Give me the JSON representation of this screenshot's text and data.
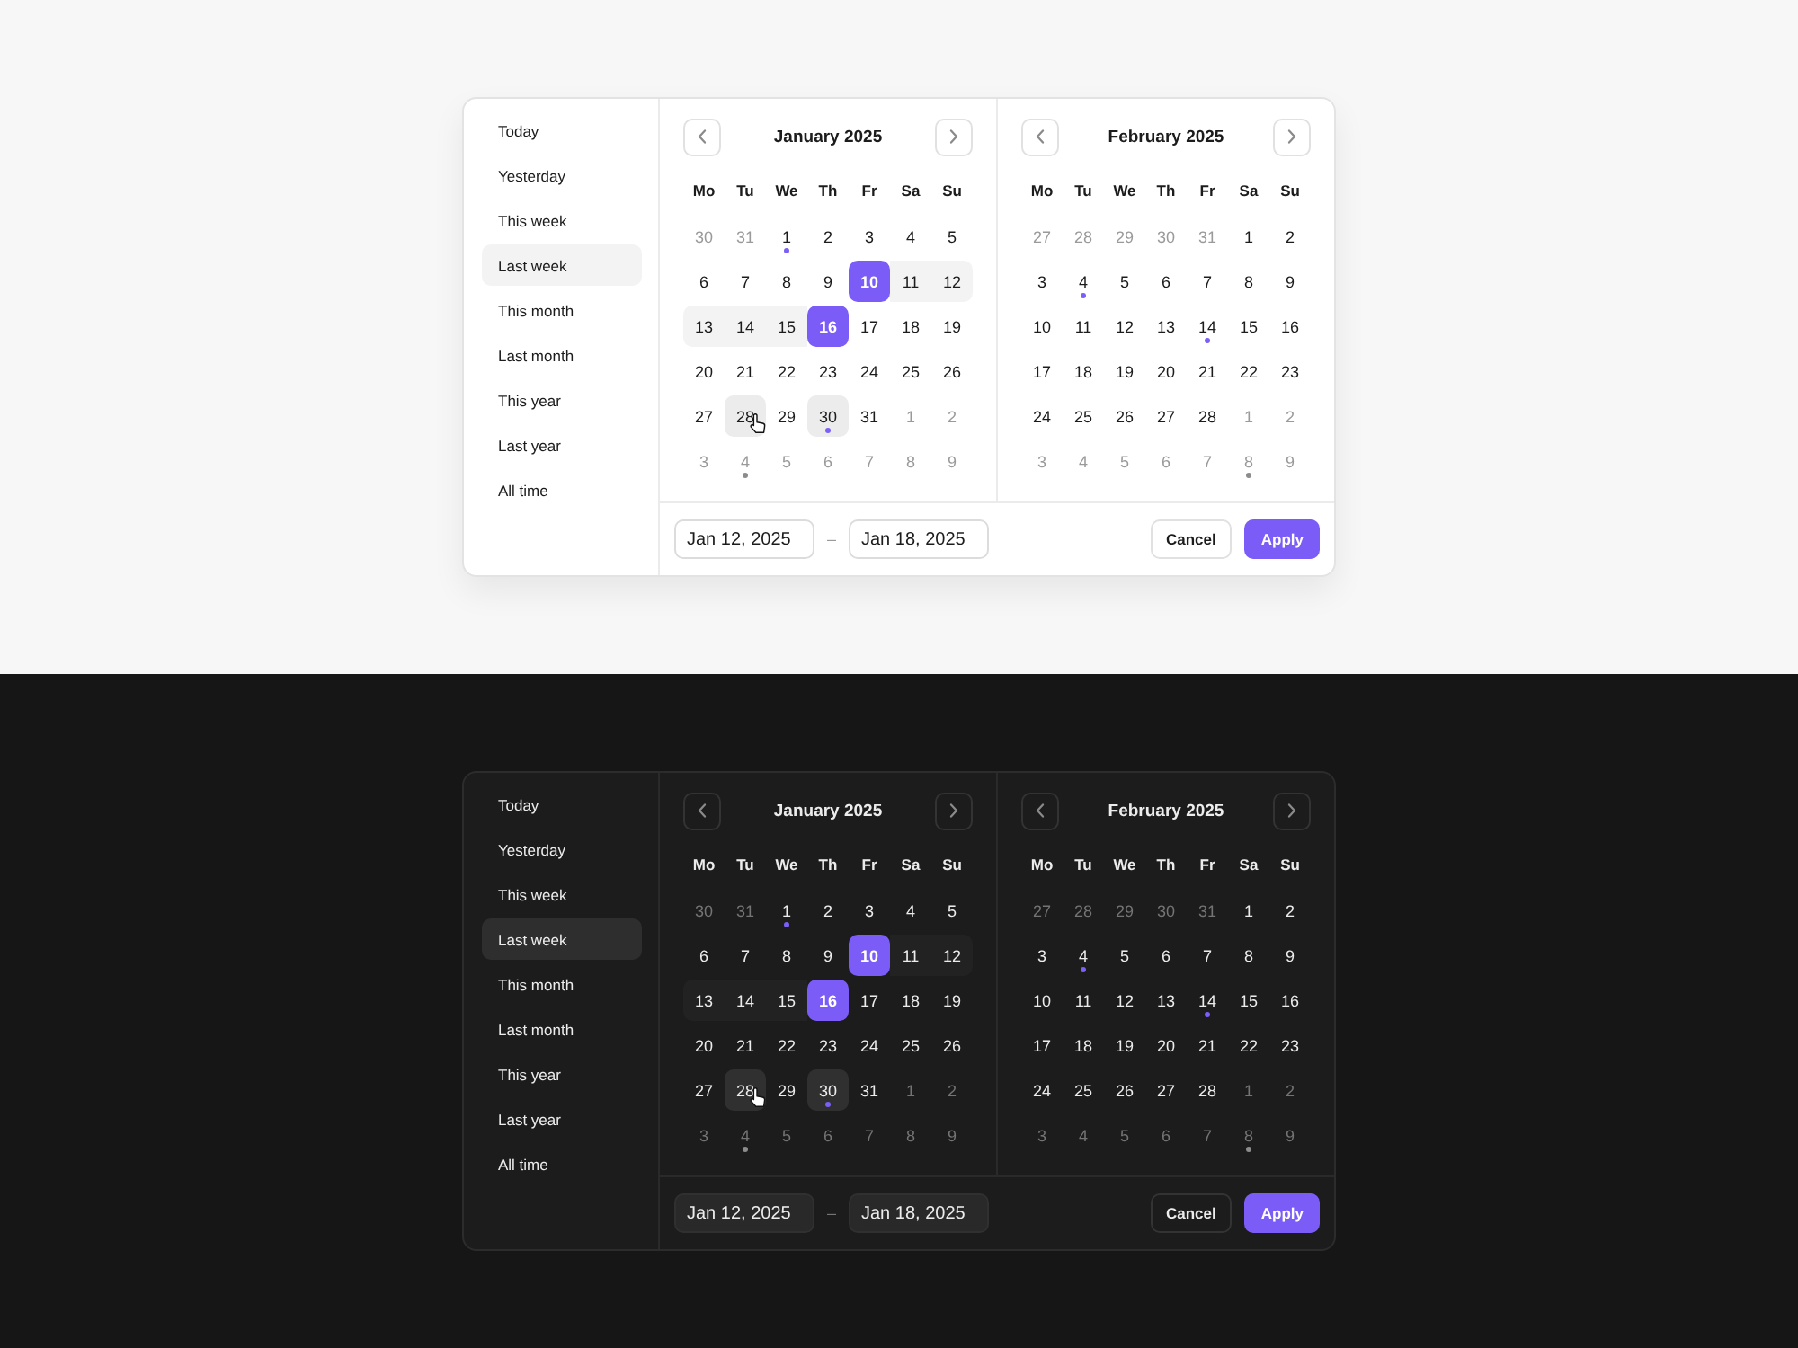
{
  "panels": [
    {
      "kind": "light",
      "presets": [
        {
          "label": "Today",
          "selected": false
        },
        {
          "label": "Yesterday",
          "selected": false
        },
        {
          "label": "This week",
          "selected": false
        },
        {
          "label": "Last week",
          "selected": true
        },
        {
          "label": "This month",
          "selected": false
        },
        {
          "label": "Last month",
          "selected": false
        },
        {
          "label": "This year",
          "selected": false
        },
        {
          "label": "Last year",
          "selected": false
        },
        {
          "label": "All time",
          "selected": false
        }
      ],
      "months": [
        {
          "title": "January 2025",
          "weekdays": [
            "Mo",
            "Tu",
            "We",
            "Th",
            "Fr",
            "Sa",
            "Su"
          ],
          "days": [
            {
              "label": "30",
              "kind": "outside",
              "selected": false
            },
            {
              "label": "31",
              "kind": "outside",
              "selected": false
            },
            {
              "label": "1",
              "kind": "plain",
              "selected": false,
              "color": "#7b5ff6"
            },
            {
              "label": "2",
              "kind": "plain",
              "selected": false
            },
            {
              "label": "3",
              "kind": "plain",
              "selected": false
            },
            {
              "label": "4",
              "kind": "plain",
              "selected": false
            },
            {
              "label": "5",
              "kind": "plain",
              "selected": false
            },
            {
              "label": "6",
              "kind": "plain",
              "selected": false
            },
            {
              "label": "7",
              "kind": "plain",
              "selected": false
            },
            {
              "label": "8",
              "kind": "plain",
              "selected": false
            },
            {
              "label": "9",
              "kind": "plain",
              "selected": false
            },
            {
              "label": "10",
              "kind": "plain",
              "selected": true
            },
            {
              "label": "11",
              "kind": "range",
              "selected": false
            },
            {
              "label": "12",
              "kind": "range",
              "selected": false
            },
            {
              "label": "13",
              "kind": "range",
              "selected": false
            },
            {
              "label": "14",
              "kind": "range",
              "selected": false
            },
            {
              "label": "15",
              "kind": "range",
              "selected": false
            },
            {
              "label": "16",
              "kind": "plain",
              "selected": true
            },
            {
              "label": "17",
              "kind": "plain",
              "selected": false
            },
            {
              "label": "18",
              "kind": "plain",
              "selected": false
            },
            {
              "label": "19",
              "kind": "plain",
              "selected": false
            },
            {
              "label": "20",
              "kind": "plain",
              "selected": false
            },
            {
              "label": "21",
              "kind": "plain",
              "selected": false
            },
            {
              "label": "22",
              "kind": "plain",
              "selected": false
            },
            {
              "label": "23",
              "kind": "plain",
              "selected": false
            },
            {
              "label": "24",
              "kind": "plain",
              "selected": false
            },
            {
              "label": "25",
              "kind": "plain",
              "selected": false
            },
            {
              "label": "26",
              "kind": "plain",
              "selected": false
            },
            {
              "label": "27",
              "kind": "plain",
              "selected": false
            },
            {
              "label": "28",
              "kind": "hover",
              "selected": false
            },
            {
              "label": "29",
              "kind": "plain",
              "selected": false
            },
            {
              "label": "30",
              "kind": "today",
              "selected": false,
              "color": "#7b5ff6"
            },
            {
              "label": "31",
              "kind": "plain",
              "selected": false
            },
            {
              "label": "1",
              "kind": "outside",
              "selected": false
            },
            {
              "label": "2",
              "kind": "outside",
              "selected": false
            },
            {
              "label": "3",
              "kind": "outside",
              "selected": false
            },
            {
              "label": "4",
              "kind": "outside",
              "selected": false,
              "color": "#8c8c8c"
            },
            {
              "label": "5",
              "kind": "outside",
              "selected": false
            },
            {
              "label": "6",
              "kind": "outside",
              "selected": false
            },
            {
              "label": "7",
              "kind": "outside",
              "selected": false
            },
            {
              "label": "8",
              "kind": "outside",
              "selected": false
            },
            {
              "label": "9",
              "kind": "outside",
              "selected": false
            }
          ]
        },
        {
          "title": "February 2025",
          "weekdays": [
            "Mo",
            "Tu",
            "We",
            "Th",
            "Fr",
            "Sa",
            "Su"
          ],
          "days": [
            {
              "label": "27",
              "kind": "outside",
              "selected": false
            },
            {
              "label": "28",
              "kind": "outside",
              "selected": false
            },
            {
              "label": "29",
              "kind": "outside",
              "selected": false
            },
            {
              "label": "30",
              "kind": "outside",
              "selected": false
            },
            {
              "label": "31",
              "kind": "outside",
              "selected": false
            },
            {
              "label": "1",
              "kind": "plain",
              "selected": false
            },
            {
              "label": "2",
              "kind": "plain",
              "selected": false
            },
            {
              "label": "3",
              "kind": "plain",
              "selected": false
            },
            {
              "label": "4",
              "kind": "plain",
              "selected": false,
              "color": "#7b5ff6"
            },
            {
              "label": "5",
              "kind": "plain",
              "selected": false
            },
            {
              "label": "6",
              "kind": "plain",
              "selected": false
            },
            {
              "label": "7",
              "kind": "plain",
              "selected": false
            },
            {
              "label": "8",
              "kind": "plain",
              "selected": false
            },
            {
              "label": "9",
              "kind": "plain",
              "selected": false
            },
            {
              "label": "10",
              "kind": "plain",
              "selected": false
            },
            {
              "label": "11",
              "kind": "plain",
              "selected": false
            },
            {
              "label": "12",
              "kind": "plain",
              "selected": false
            },
            {
              "label": "13",
              "kind": "plain",
              "selected": false
            },
            {
              "label": "14",
              "kind": "plain",
              "selected": false,
              "color": "#7b5ff6"
            },
            {
              "label": "15",
              "kind": "plain",
              "selected": false
            },
            {
              "label": "16",
              "kind": "plain",
              "selected": false
            },
            {
              "label": "17",
              "kind": "plain",
              "selected": false
            },
            {
              "label": "18",
              "kind": "plain",
              "selected": false
            },
            {
              "label": "19",
              "kind": "plain",
              "selected": false
            },
            {
              "label": "20",
              "kind": "plain",
              "selected": false
            },
            {
              "label": "21",
              "kind": "plain",
              "selected": false
            },
            {
              "label": "22",
              "kind": "plain",
              "selected": false
            },
            {
              "label": "23",
              "kind": "plain",
              "selected": false
            },
            {
              "label": "24",
              "kind": "plain",
              "selected": false
            },
            {
              "label": "25",
              "kind": "plain",
              "selected": false
            },
            {
              "label": "26",
              "kind": "plain",
              "selected": false
            },
            {
              "label": "27",
              "kind": "plain",
              "selected": false
            },
            {
              "label": "28",
              "kind": "plain",
              "selected": false
            },
            {
              "label": "1",
              "kind": "outside",
              "selected": false
            },
            {
              "label": "2",
              "kind": "outside",
              "selected": false
            },
            {
              "label": "3",
              "kind": "outside",
              "selected": false
            },
            {
              "label": "4",
              "kind": "outside",
              "selected": false
            },
            {
              "label": "5",
              "kind": "outside",
              "selected": false
            },
            {
              "label": "6",
              "kind": "outside",
              "selected": false
            },
            {
              "label": "7",
              "kind": "outside",
              "selected": false
            },
            {
              "label": "8",
              "kind": "outside",
              "selected": false,
              "color": "#8c8c8c"
            },
            {
              "label": "9",
              "kind": "outside",
              "selected": false
            }
          ]
        }
      ],
      "start_date": "Jan 12, 2025",
      "separator": "–",
      "end_date": "Jan 18, 2025",
      "buttons": [
        {
          "label": "Cancel",
          "kind": "secondary"
        },
        {
          "label": "Apply",
          "kind": "primary"
        }
      ]
    },
    {
      "kind": "dark",
      "presets": [
        {
          "label": "Today",
          "selected": false
        },
        {
          "label": "Yesterday",
          "selected": false
        },
        {
          "label": "This week",
          "selected": false
        },
        {
          "label": "Last week",
          "selected": true
        },
        {
          "label": "This month",
          "selected": false
        },
        {
          "label": "Last month",
          "selected": false
        },
        {
          "label": "This year",
          "selected": false
        },
        {
          "label": "Last year",
          "selected": false
        },
        {
          "label": "All time",
          "selected": false
        }
      ],
      "months": [
        {
          "title": "January 2025",
          "weekdays": [
            "Mo",
            "Tu",
            "We",
            "Th",
            "Fr",
            "Sa",
            "Su"
          ],
          "days": [
            {
              "label": "30",
              "kind": "outside",
              "selected": false
            },
            {
              "label": "31",
              "kind": "outside",
              "selected": false
            },
            {
              "label": "1",
              "kind": "plain",
              "selected": false,
              "color": "#7b5ff6"
            },
            {
              "label": "2",
              "kind": "plain",
              "selected": false
            },
            {
              "label": "3",
              "kind": "plain",
              "selected": false
            },
            {
              "label": "4",
              "kind": "plain",
              "selected": false
            },
            {
              "label": "5",
              "kind": "plain",
              "selected": false
            },
            {
              "label": "6",
              "kind": "plain",
              "selected": false
            },
            {
              "label": "7",
              "kind": "plain",
              "selected": false
            },
            {
              "label": "8",
              "kind": "plain",
              "selected": false
            },
            {
              "label": "9",
              "kind": "plain",
              "selected": false
            },
            {
              "label": "10",
              "kind": "plain",
              "selected": true
            },
            {
              "label": "11",
              "kind": "range",
              "selected": false
            },
            {
              "label": "12",
              "kind": "range",
              "selected": false
            },
            {
              "label": "13",
              "kind": "range",
              "selected": false
            },
            {
              "label": "14",
              "kind": "range",
              "selected": false
            },
            {
              "label": "15",
              "kind": "range",
              "selected": false
            },
            {
              "label": "16",
              "kind": "plain",
              "selected": true
            },
            {
              "label": "17",
              "kind": "plain",
              "selected": false
            },
            {
              "label": "18",
              "kind": "plain",
              "selected": false
            },
            {
              "label": "19",
              "kind": "plain",
              "selected": false
            },
            {
              "label": "20",
              "kind": "plain",
              "selected": false
            },
            {
              "label": "21",
              "kind": "plain",
              "selected": false
            },
            {
              "label": "22",
              "kind": "plain",
              "selected": false
            },
            {
              "label": "23",
              "kind": "plain",
              "selected": false
            },
            {
              "label": "24",
              "kind": "plain",
              "selected": false
            },
            {
              "label": "25",
              "kind": "plain",
              "selected": false
            },
            {
              "label": "26",
              "kind": "plain",
              "selected": false
            },
            {
              "label": "27",
              "kind": "plain",
              "selected": false
            },
            {
              "label": "28",
              "kind": "hover",
              "selected": false
            },
            {
              "label": "29",
              "kind": "plain",
              "selected": false
            },
            {
              "label": "30",
              "kind": "today",
              "selected": false,
              "color": "#7b5ff6"
            },
            {
              "label": "31",
              "kind": "plain",
              "selected": false
            },
            {
              "label": "1",
              "kind": "outside",
              "selected": false
            },
            {
              "label": "2",
              "kind": "outside",
              "selected": false
            },
            {
              "label": "3",
              "kind": "outside",
              "selected": false
            },
            {
              "label": "4",
              "kind": "outside",
              "selected": false,
              "color": "#8c8c8c"
            },
            {
              "label": "5",
              "kind": "outside",
              "selected": false
            },
            {
              "label": "6",
              "kind": "outside",
              "selected": false
            },
            {
              "label": "7",
              "kind": "outside",
              "selected": false
            },
            {
              "label": "8",
              "kind": "outside",
              "selected": false
            },
            {
              "label": "9",
              "kind": "outside",
              "selected": false
            }
          ]
        },
        {
          "title": "February 2025",
          "weekdays": [
            "Mo",
            "Tu",
            "We",
            "Th",
            "Fr",
            "Sa",
            "Su"
          ],
          "days": [
            {
              "label": "27",
              "kind": "outside",
              "selected": false
            },
            {
              "label": "28",
              "kind": "outside",
              "selected": false
            },
            {
              "label": "29",
              "kind": "outside",
              "selected": false
            },
            {
              "label": "30",
              "kind": "outside",
              "selected": false
            },
            {
              "label": "31",
              "kind": "outside",
              "selected": false
            },
            {
              "label": "1",
              "kind": "plain",
              "selected": false
            },
            {
              "label": "2",
              "kind": "plain",
              "selected": false
            },
            {
              "label": "3",
              "kind": "plain",
              "selected": false
            },
            {
              "label": "4",
              "kind": "plain",
              "selected": false,
              "color": "#7b5ff6"
            },
            {
              "label": "5",
              "kind": "plain",
              "selected": false
            },
            {
              "label": "6",
              "kind": "plain",
              "selected": false
            },
            {
              "label": "7",
              "kind": "plain",
              "selected": false
            },
            {
              "label": "8",
              "kind": "plain",
              "selected": false
            },
            {
              "label": "9",
              "kind": "plain",
              "selected": false
            },
            {
              "label": "10",
              "kind": "plain",
              "selected": false
            },
            {
              "label": "11",
              "kind": "plain",
              "selected": false
            },
            {
              "label": "12",
              "kind": "plain",
              "selected": false
            },
            {
              "label": "13",
              "kind": "plain",
              "selected": false
            },
            {
              "label": "14",
              "kind": "plain",
              "selected": false,
              "color": "#7b5ff6"
            },
            {
              "label": "15",
              "kind": "plain",
              "selected": false
            },
            {
              "label": "16",
              "kind": "plain",
              "selected": false
            },
            {
              "label": "17",
              "kind": "plain",
              "selected": false
            },
            {
              "label": "18",
              "kind": "plain",
              "selected": false
            },
            {
              "label": "19",
              "kind": "plain",
              "selected": false
            },
            {
              "label": "20",
              "kind": "plain",
              "selected": false
            },
            {
              "label": "21",
              "kind": "plain",
              "selected": false
            },
            {
              "label": "22",
              "kind": "plain",
              "selected": false
            },
            {
              "label": "23",
              "kind": "plain",
              "selected": false
            },
            {
              "label": "24",
              "kind": "plain",
              "selected": false
            },
            {
              "label": "25",
              "kind": "plain",
              "selected": false
            },
            {
              "label": "26",
              "kind": "plain",
              "selected": false
            },
            {
              "label": "27",
              "kind": "plain",
              "selected": false
            },
            {
              "label": "28",
              "kind": "plain",
              "selected": false
            },
            {
              "label": "1",
              "kind": "outside",
              "selected": false
            },
            {
              "label": "2",
              "kind": "outside",
              "selected": false
            },
            {
              "label": "3",
              "kind": "outside",
              "selected": false
            },
            {
              "label": "4",
              "kind": "outside",
              "selected": false
            },
            {
              "label": "5",
              "kind": "outside",
              "selected": false
            },
            {
              "label": "6",
              "kind": "outside",
              "selected": false
            },
            {
              "label": "7",
              "kind": "outside",
              "selected": false
            },
            {
              "label": "8",
              "kind": "outside",
              "selected": false,
              "color": "#8c8c8c"
            },
            {
              "label": "9",
              "kind": "outside",
              "selected": false
            }
          ]
        }
      ],
      "start_date": "Jan 12, 2025",
      "separator": "–",
      "end_date": "Jan 18, 2025",
      "buttons": [
        {
          "label": "Cancel",
          "kind": "secondary"
        },
        {
          "label": "Apply",
          "kind": "primary"
        }
      ]
    }
  ]
}
